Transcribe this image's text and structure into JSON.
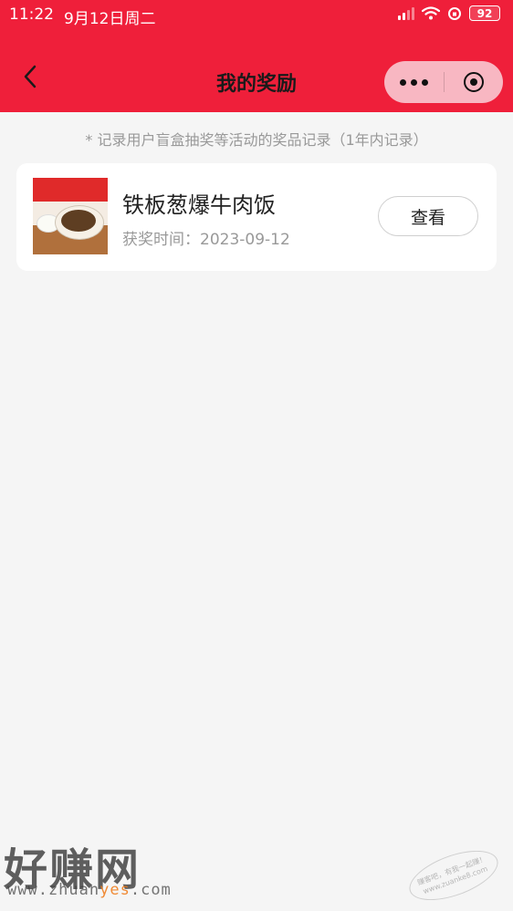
{
  "status_bar": {
    "time": "11:22",
    "date": "9月12日周二",
    "battery": "92"
  },
  "nav": {
    "title": "我的奖励"
  },
  "notice": "* 记录用户盲盒抽奖等活动的奖品记录（1年内记录）",
  "prizes": [
    {
      "name": "铁板葱爆牛肉饭",
      "date_label": "获奖时间：2023-09-12",
      "button_label": "查看"
    }
  ],
  "watermark": {
    "logo": "好赚网",
    "url_prefix": "www.zhuan",
    "url_highlight": "yes",
    "url_suffix": ".com",
    "stamp_line1": "赚客吧，有我一起赚！",
    "stamp_line2": "www.zuanke8.com"
  },
  "colors": {
    "brand_red": "#ef1f3a",
    "capsule_pink": "#f8b7c2",
    "page_bg": "#f5f5f5"
  }
}
